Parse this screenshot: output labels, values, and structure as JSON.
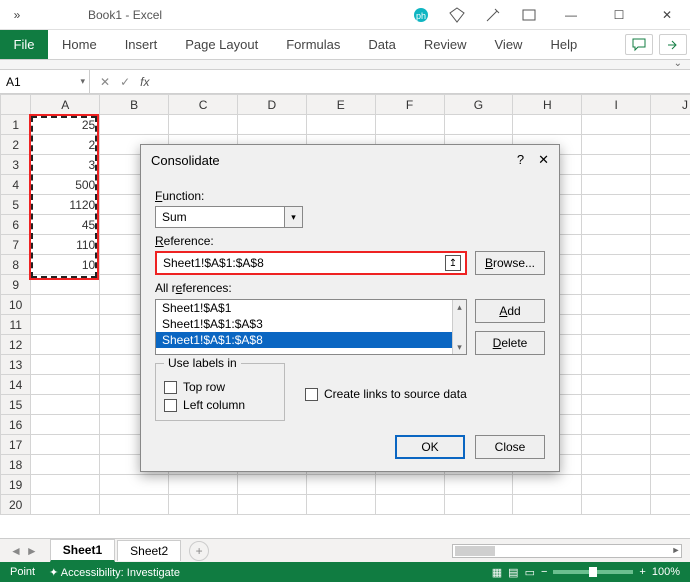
{
  "title": "Book1 - Excel",
  "ribbon": {
    "file": "File",
    "tabs": [
      "Home",
      "Insert",
      "Page Layout",
      "Formulas",
      "Data",
      "Review",
      "View",
      "Help"
    ]
  },
  "namebox": "A1",
  "columns": [
    "A",
    "B",
    "C",
    "D",
    "E",
    "F",
    "G",
    "H",
    "I",
    "J"
  ],
  "rows_count": 20,
  "cells_A": [
    "25",
    "2",
    "3",
    "500",
    "1120",
    "45",
    "110",
    "10"
  ],
  "sheets": {
    "active": "Sheet1",
    "other": "Sheet2"
  },
  "status": {
    "mode": "Point",
    "acc": "Accessibility: Investigate",
    "zoom": "100%"
  },
  "dialog": {
    "title": "Consolidate",
    "function_label": "Function:",
    "function_value": "Sum",
    "reference_label": "Reference:",
    "reference_value": "Sheet1!$A$1:$A$8",
    "browse": "Browse...",
    "all_refs_label": "All references:",
    "refs": [
      "Sheet1!$A$1",
      "Sheet1!$A$1:$A$3",
      "Sheet1!$A$1:$A$8"
    ],
    "add": "Add",
    "delete": "Delete",
    "use_labels": "Use labels in",
    "top_row": "Top row",
    "left_col": "Left column",
    "create_links": "Create links to source data",
    "ok": "OK",
    "close": "Close"
  }
}
